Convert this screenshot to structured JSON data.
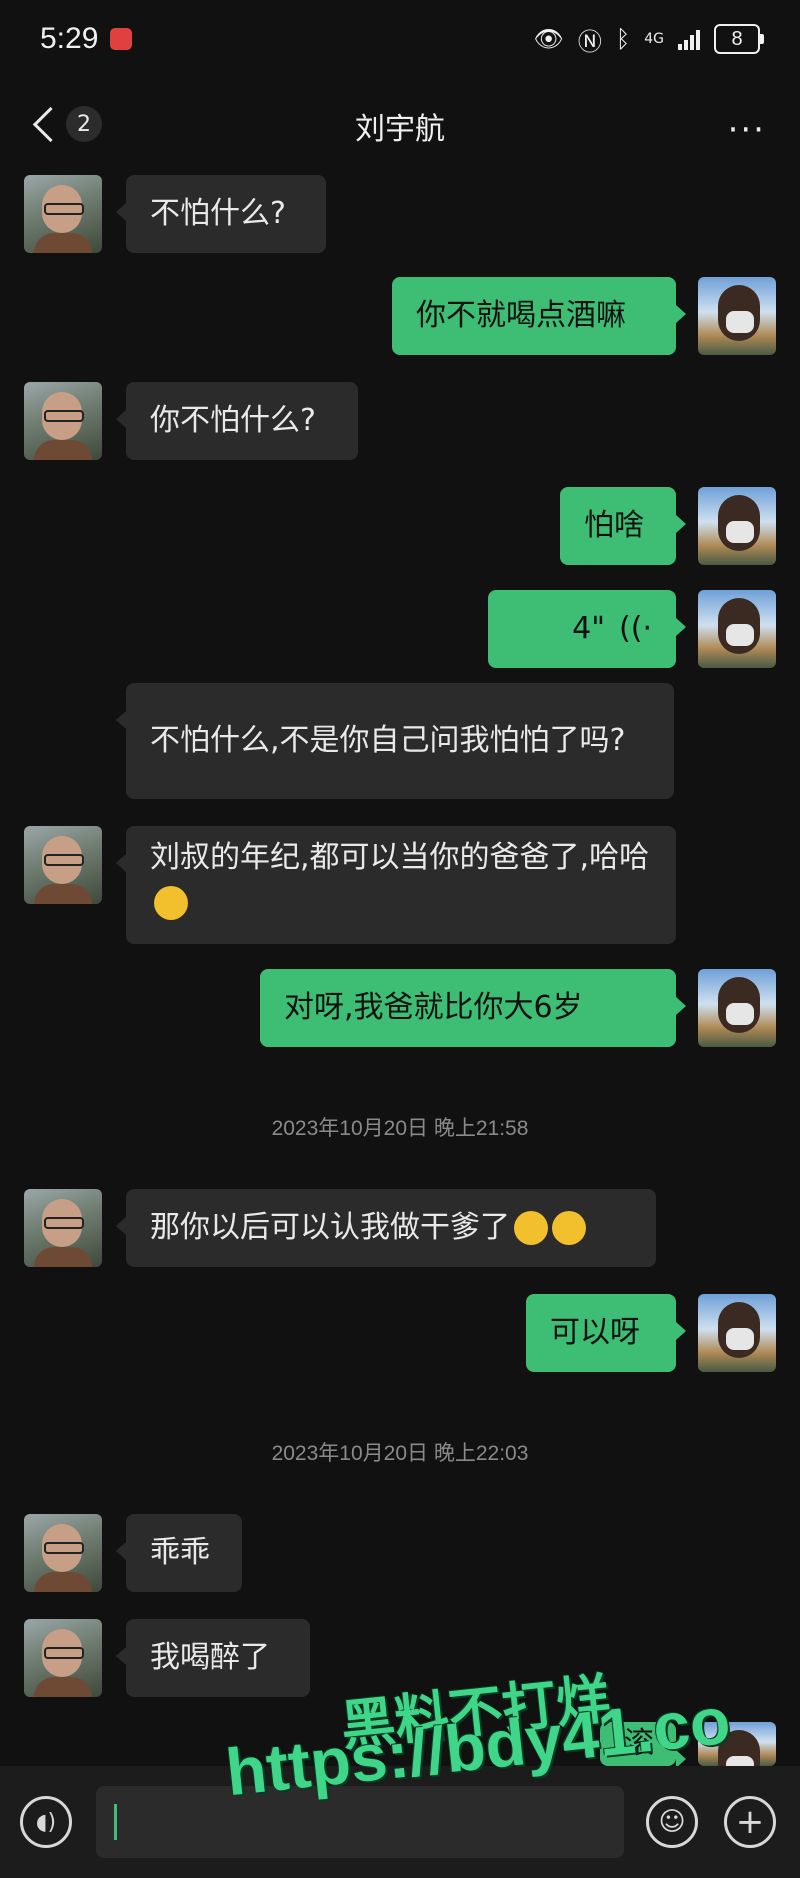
{
  "status_bar": {
    "time": "5:29",
    "network": "4G",
    "battery": "8"
  },
  "header": {
    "back_count": "2",
    "title": "刘宇航",
    "more": "···"
  },
  "messages": [
    {
      "side": "in",
      "text": "不怕什么?"
    },
    {
      "side": "out",
      "text": "你不就喝点酒嘛"
    },
    {
      "side": "in",
      "text": "你不怕什么?"
    },
    {
      "side": "out",
      "text": "怕啥"
    },
    {
      "side": "out",
      "type": "voice",
      "duration": "4\""
    },
    {
      "side": "in",
      "text": "不怕什么,不是你自己问我怕怕了吗?"
    },
    {
      "side": "in",
      "text": "刘叔的年纪,都可以当你的爸爸了,哈哈",
      "emoji": [
        "grin"
      ]
    },
    {
      "side": "out",
      "text": "对呀,我爸就比你大6岁"
    },
    {
      "type": "timestamp",
      "text": "2023年10月20日 晚上21:58"
    },
    {
      "side": "in",
      "text": "那你以后可以认我做干爹了",
      "emoji": [
        "grin",
        "wink-tongue"
      ]
    },
    {
      "side": "out",
      "text": "可以呀"
    },
    {
      "type": "timestamp",
      "text": "2023年10月20日 晚上22:03"
    },
    {
      "side": "in",
      "text": "乖乖"
    },
    {
      "side": "in",
      "text": "我喝醉了"
    },
    {
      "side": "out",
      "text": "滚"
    }
  ],
  "watermark": {
    "line1": "黑料不打烊",
    "line2": "https://bdy41.co"
  },
  "icons": {
    "voice": "voice-input-icon",
    "emoji": "emoji-icon",
    "plus": "plus-icon"
  }
}
